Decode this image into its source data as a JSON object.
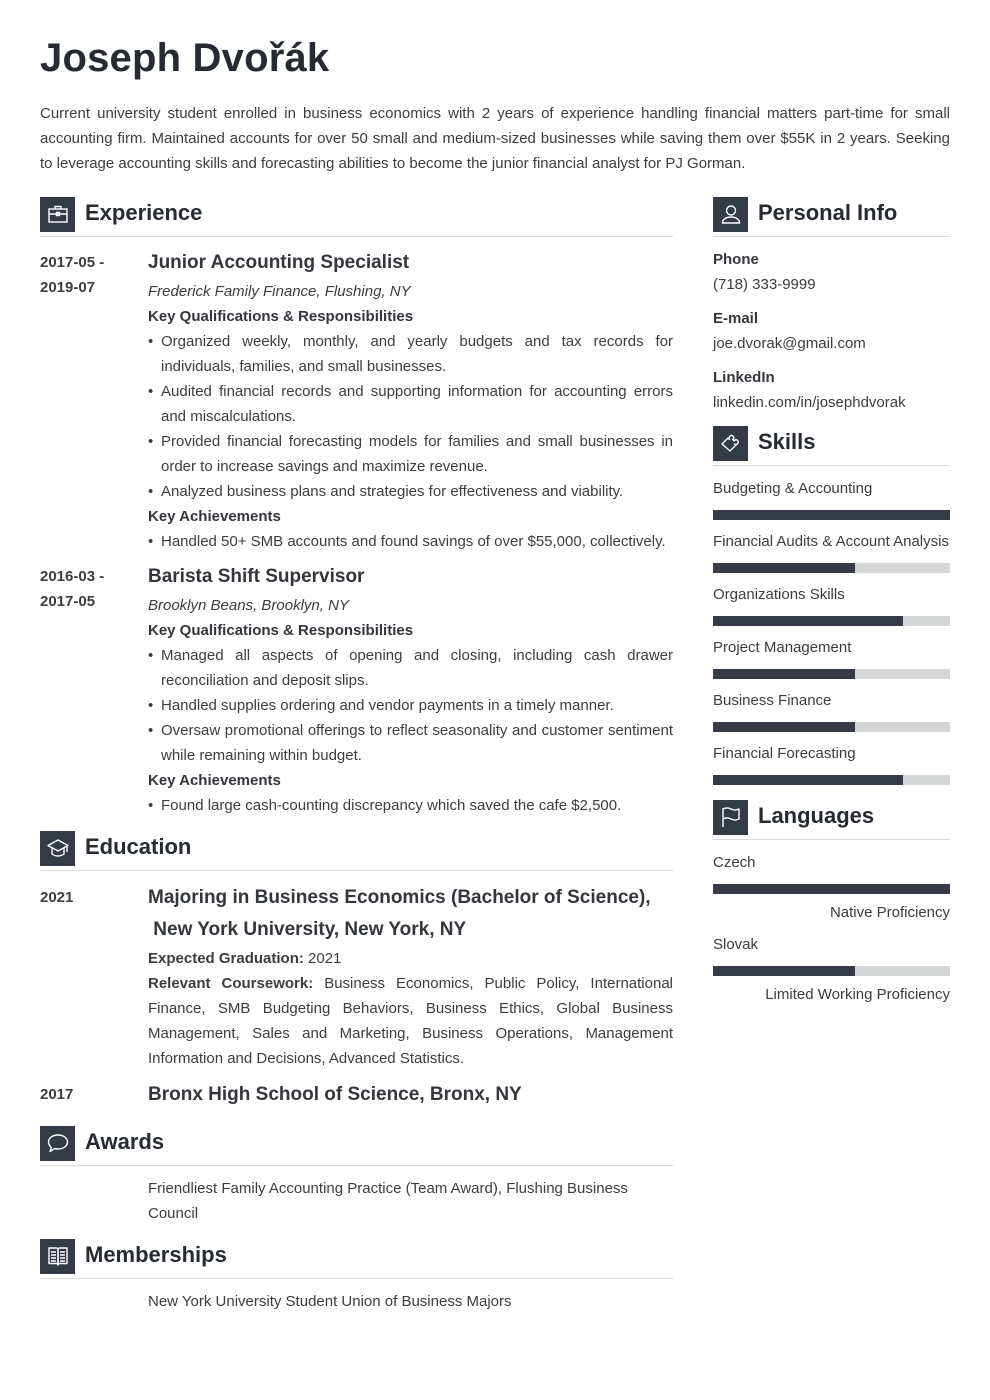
{
  "header": {
    "name": "Joseph Dvořák",
    "summary": "Current university student enrolled in business economics with 2 years of experience handling financial matters part-time for small accounting firm. Maintained accounts for over 50 small and medium-sized businesses while saving them over $55K in 2 years. Seeking to leverage accounting skills and forecasting abilities to become the junior financial analyst for PJ Gorman."
  },
  "experience": {
    "title": "Experience",
    "icon": "briefcase-icon",
    "jobs": [
      {
        "date_start": "2017-05 -",
        "date_end": "2019-07",
        "title": "Junior Accounting Specialist",
        "company": "Frederick Family Finance, Flushing, NY",
        "qual_heading": "Key Qualifications & Responsibilities",
        "responsibilities": [
          "Organized weekly, monthly, and yearly budgets and tax records for individuals, families, and small businesses.",
          "Audited financial records and supporting information for accounting errors and miscalculations.",
          "Provided financial forecasting models for families and small businesses in order to increase savings and maximize revenue.",
          "Analyzed business plans and strategies for effectiveness and viability."
        ],
        "ach_heading": "Key Achievements",
        "achievements": [
          "Handled 50+ SMB accounts and found savings of over $55,000, collectively."
        ]
      },
      {
        "date_start": "2016-03 -",
        "date_end": "2017-05",
        "title": "Barista Shift Supervisor",
        "company": "Brooklyn Beans, Brooklyn, NY",
        "qual_heading": "Key Qualifications & Responsibilities",
        "responsibilities": [
          "Managed all aspects of opening and closing, including cash drawer reconciliation and deposit slips.",
          "Handled supplies ordering and vendor payments in a timely manner.",
          "Oversaw promotional offerings to reflect seasonality and customer sentiment while remaining within budget."
        ],
        "ach_heading": "Key Achievements",
        "achievements": [
          "Found large cash-counting discrepancy which saved the cafe $2,500."
        ]
      }
    ]
  },
  "education": {
    "title": "Education",
    "icon": "graduation-cap-icon",
    "entries": [
      {
        "date": "2021",
        "title_line1": "Majoring in Business Economics (Bachelor of Science),",
        "title_line2": " New York University, New York, NY",
        "grad_label": "Expected Graduation:",
        "grad_value": "2021",
        "course_label": "Relevant Coursework:",
        "course_value": "Business Economics, Public Policy, International Finance, SMB Budgeting Behaviors, Business Ethics, Global Business Management, Sales and Marketing, Business Operations, Management Information and Decisions, Advanced Statistics."
      },
      {
        "date": "2017",
        "title_line1": "Bronx High School of Science, Bronx, NY"
      }
    ]
  },
  "awards": {
    "title": "Awards",
    "icon": "speech-bubble-icon",
    "text": "Friendliest Family Accounting Practice (Team Award), Flushing Business Council"
  },
  "memberships": {
    "title": "Memberships",
    "icon": "open-book-icon",
    "text": "New York University Student Union of Business Majors"
  },
  "personal_info": {
    "title": "Personal Info",
    "icon": "user-icon",
    "phone_label": "Phone",
    "phone": "(718) 333-9999",
    "email_label": "E-mail",
    "email": "joe.dvorak@gmail.com",
    "linkedin_label": "LinkedIn",
    "linkedin": "linkedin.com/in/josephdvorak"
  },
  "skills": {
    "title": "Skills",
    "icon": "puzzle-piece-icon",
    "items": [
      {
        "name": "Budgeting & Accounting",
        "level": 1.0
      },
      {
        "name": "Financial Audits & Account Analysis",
        "level": 0.6
      },
      {
        "name": "Organizations Skills",
        "level": 0.8
      },
      {
        "name": "Project Management",
        "level": 0.6
      },
      {
        "name": "Business Finance",
        "level": 0.6
      },
      {
        "name": "Financial Forecasting",
        "level": 0.8
      }
    ]
  },
  "languages": {
    "title": "Languages",
    "icon": "flag-icon",
    "items": [
      {
        "name": "Czech",
        "level": 1.0,
        "proficiency": "Native Proficiency"
      },
      {
        "name": "Slovak",
        "level": 0.6,
        "proficiency": "Limited Working Proficiency"
      }
    ]
  },
  "colors": {
    "accent": "#343a46",
    "bar_track": "#d5d7d6",
    "heading": "#262a33",
    "text": "#3b3d40"
  }
}
